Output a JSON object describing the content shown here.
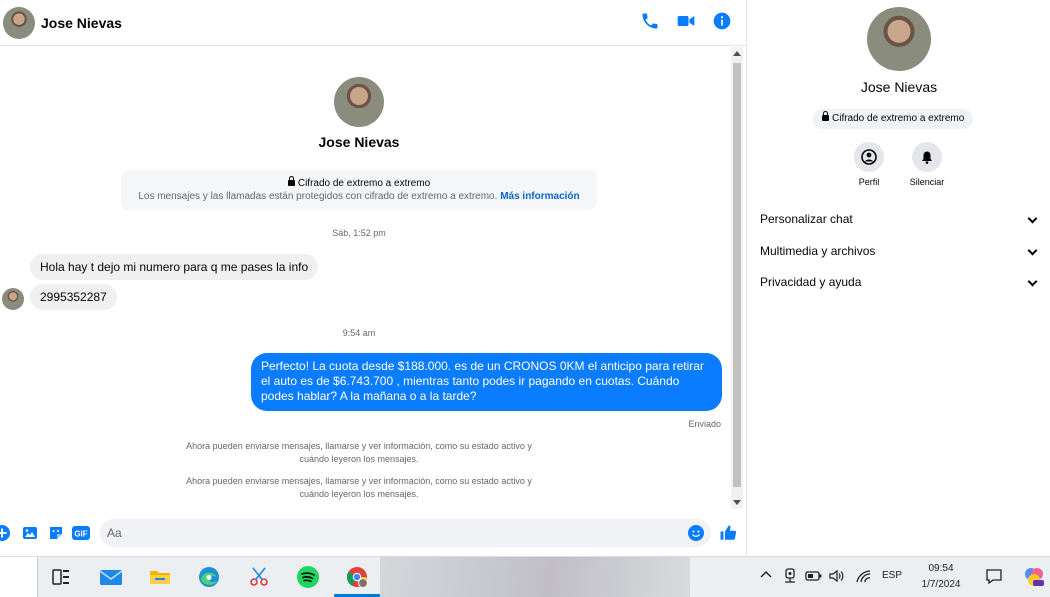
{
  "contact": {
    "name": "Jose Nievas"
  },
  "encryption": {
    "title": "Cifrado de extremo a extremo",
    "description": "Los mensajes y las llamadas están protegidos con cifrado de extremo a extremo.",
    "link": "Más información"
  },
  "messages": {
    "timestamp1": "Sáb, 1:52 pm",
    "incoming": [
      "Hola hay t dejo mi numero para q me pases la info",
      "2995352287"
    ],
    "timestamp2": "9:54 am",
    "outgoing": "Perfecto! La cuota desde $188.000. es de un CRONOS 0KM el anticipo para retirar el auto es de $6.743.700 , mientras tanto podes ir pagando en cuotas. Cuándo podes hablar? A la mañana o a la tarde?",
    "sent_status": "Enviado",
    "system": [
      "Ahora pueden enviarse mensajes, llamarse y ver información, como su estado activo y cuándo leyeron los mensajes.",
      "Ahora pueden enviarse mensajes, llamarse y ver información, como su estado activo y cuándo leyeron los mensajes."
    ]
  },
  "composer": {
    "placeholder": "Aa",
    "gif_label": "GIF"
  },
  "info_panel": {
    "name": "Jose Nievas",
    "badge": "Cifrado de extremo a extremo",
    "profile_label": "Perfil",
    "mute_label": "Silenciar",
    "sections": [
      "Personalizar chat",
      "Multimedia y archivos",
      "Privacidad y ayuda"
    ]
  },
  "taskbar": {
    "language": "ESP",
    "time": "09:54",
    "date": "1/7/2024"
  },
  "colors": {
    "accent": "#0a7cff",
    "link": "#0a64cd"
  }
}
